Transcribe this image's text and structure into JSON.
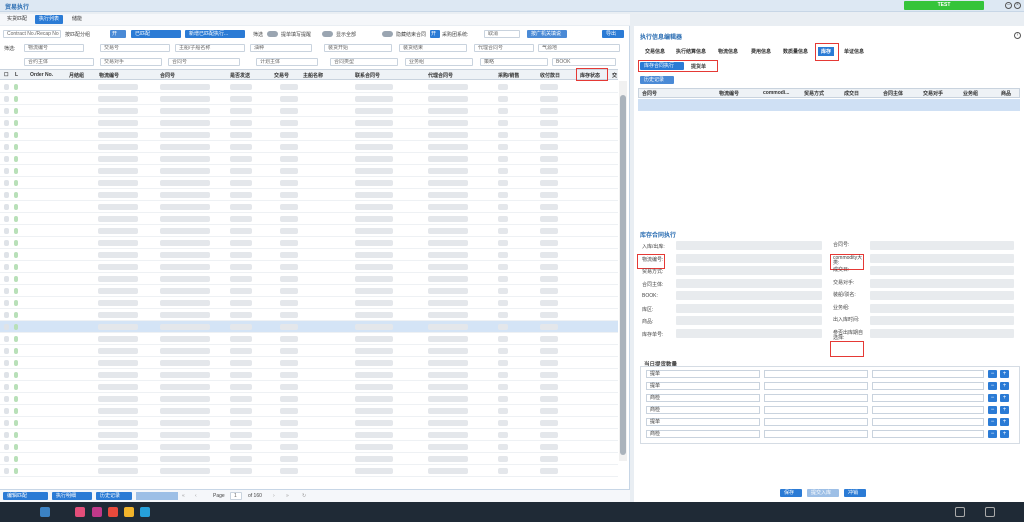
{
  "app": {
    "title": "贸易执行",
    "badge": "TEST"
  },
  "tabs": [
    "实货匹配",
    "执行列表",
    "储能"
  ],
  "filters": {
    "row1": {
      "search_placeholder": "Contract No./Recap No",
      "group_label": "按匹配分组",
      "matched_label": "已匹配",
      "new_match_label": "新增已匹配执行...",
      "filter_label": "筛选",
      "fill_label": "提单填写提醒",
      "show_all_label": "显示全部",
      "hide_closed_label": "隐藏结束合同",
      "system_label": "采购团系统:",
      "system_value": "取消",
      "forecast_label": "按广机关填说",
      "export_label": "导出"
    },
    "row2": [
      "筛选:",
      "物流编号",
      "交易号",
      "主船/子船名称",
      "油种",
      "装货开始",
      "装货结束",
      "代理合同号",
      "气源地"
    ],
    "row3": [
      "合约主体",
      "交易对手",
      "合同号",
      "计划主体",
      "合同类型",
      "业务组",
      "策略",
      "BOOK"
    ]
  },
  "table": {
    "headers": [
      "L",
      "Order No.",
      "月结组",
      "物流编号",
      "合同号",
      "是否发送",
      "交易号",
      "主船名称",
      "联系合同号",
      "代理合同号",
      "采购/销售",
      "收付款日",
      "库存状态",
      "交"
    ],
    "row_count": 33
  },
  "pager": {
    "btn1": "编辑匹配",
    "btn2": "执行明细",
    "btn3": "历史记录",
    "page_label": "Page",
    "page_value": "1",
    "of_label": "of 160"
  },
  "panel": {
    "title": "执行信息编辑器",
    "tabs": [
      "交易信息",
      "执行结算信息",
      "物流信息",
      "费用信息",
      "数质量信息",
      "库存",
      "单证信息"
    ],
    "active_tab": "库存",
    "subtabs": [
      "库存合同执行",
      "提货单"
    ],
    "history_btn": "历史记录",
    "grid_headers": [
      "合同号",
      "物流编号",
      "commodi...",
      "贸易方式",
      "成交日",
      "合同主体",
      "交易对手",
      "业务组",
      "商品"
    ],
    "section_title": "库存合同执行",
    "fields_left": [
      "入库/出库:",
      "物流编号:",
      "贸易方式:",
      "合同主体:",
      "BOOK:",
      "库区:",
      "商品:",
      "库存单号:"
    ],
    "fields_right": [
      "合同号:",
      "commodity大类:",
      "成交日:",
      "交易对手:",
      "装船/驳名:",
      "业务组:",
      "出入库时间:",
      "参否出库期自选择:"
    ],
    "quantity_title": "当日提货数量",
    "quantity_rows": [
      "提单",
      "提单",
      "商检",
      "商检",
      "提单",
      "商检"
    ],
    "buttons": [
      "保存",
      "提交入库",
      "冲销"
    ]
  },
  "colors": {
    "accent": "#2b7bd5",
    "highlight": "#e53935",
    "badge": "#35c43a"
  }
}
